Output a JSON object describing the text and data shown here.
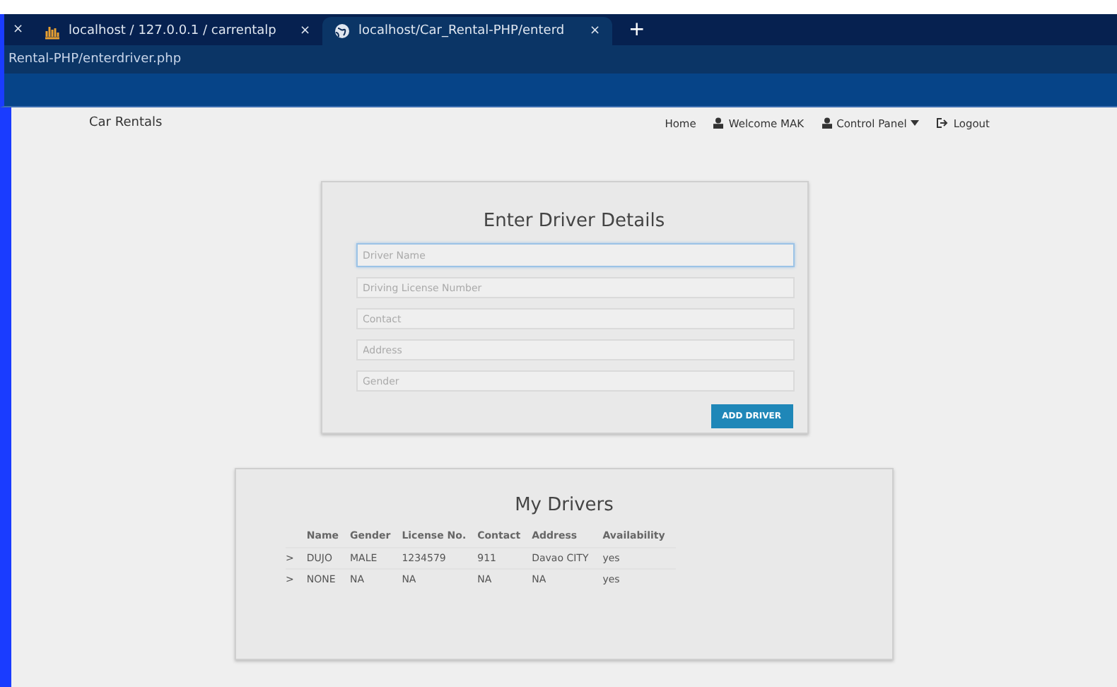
{
  "browser": {
    "close_glyph": "×",
    "tabs": [
      {
        "title": "localhost / 127.0.0.1 / carrentalp",
        "kind": "chart",
        "close": "×",
        "selected": false
      },
      {
        "title": "localhost/Car_Rental-PHP/enterd",
        "kind": "globe",
        "close": "×",
        "selected": true
      }
    ],
    "new_tab": "+",
    "address": "Rental-PHP/enterdriver.php"
  },
  "navbar": {
    "brand": "Car Rentals",
    "links": [
      {
        "label": "Home",
        "kind": "plain"
      },
      {
        "label": "Welcome MAK",
        "kind": "user"
      },
      {
        "label": "Control Panel",
        "kind": "user",
        "dropdown": true
      },
      {
        "label": "Logout",
        "kind": "logout"
      }
    ]
  },
  "form": {
    "title": "Enter Driver Details",
    "fields": [
      {
        "placeholder": "Driver Name",
        "focused": true
      },
      {
        "placeholder": "Driving License Number",
        "focused": false
      },
      {
        "placeholder": "Contact",
        "focused": false
      },
      {
        "placeholder": "Address",
        "focused": false
      },
      {
        "placeholder": "Gender",
        "focused": false
      }
    ],
    "button": "ADD DRIVER"
  },
  "drivers": {
    "title": "My Drivers",
    "columns": [
      "Name",
      "Gender",
      "License No.",
      "Contact",
      "Address",
      "Availability"
    ],
    "rows": [
      {
        "marker": ">",
        "cells": [
          "DUJO",
          "MALE",
          "1234579",
          "911",
          "Davao CITY",
          "yes"
        ]
      },
      {
        "marker": ">",
        "cells": [
          "NONE",
          "NA",
          "NA",
          "NA",
          "NA",
          "yes"
        ]
      }
    ]
  }
}
